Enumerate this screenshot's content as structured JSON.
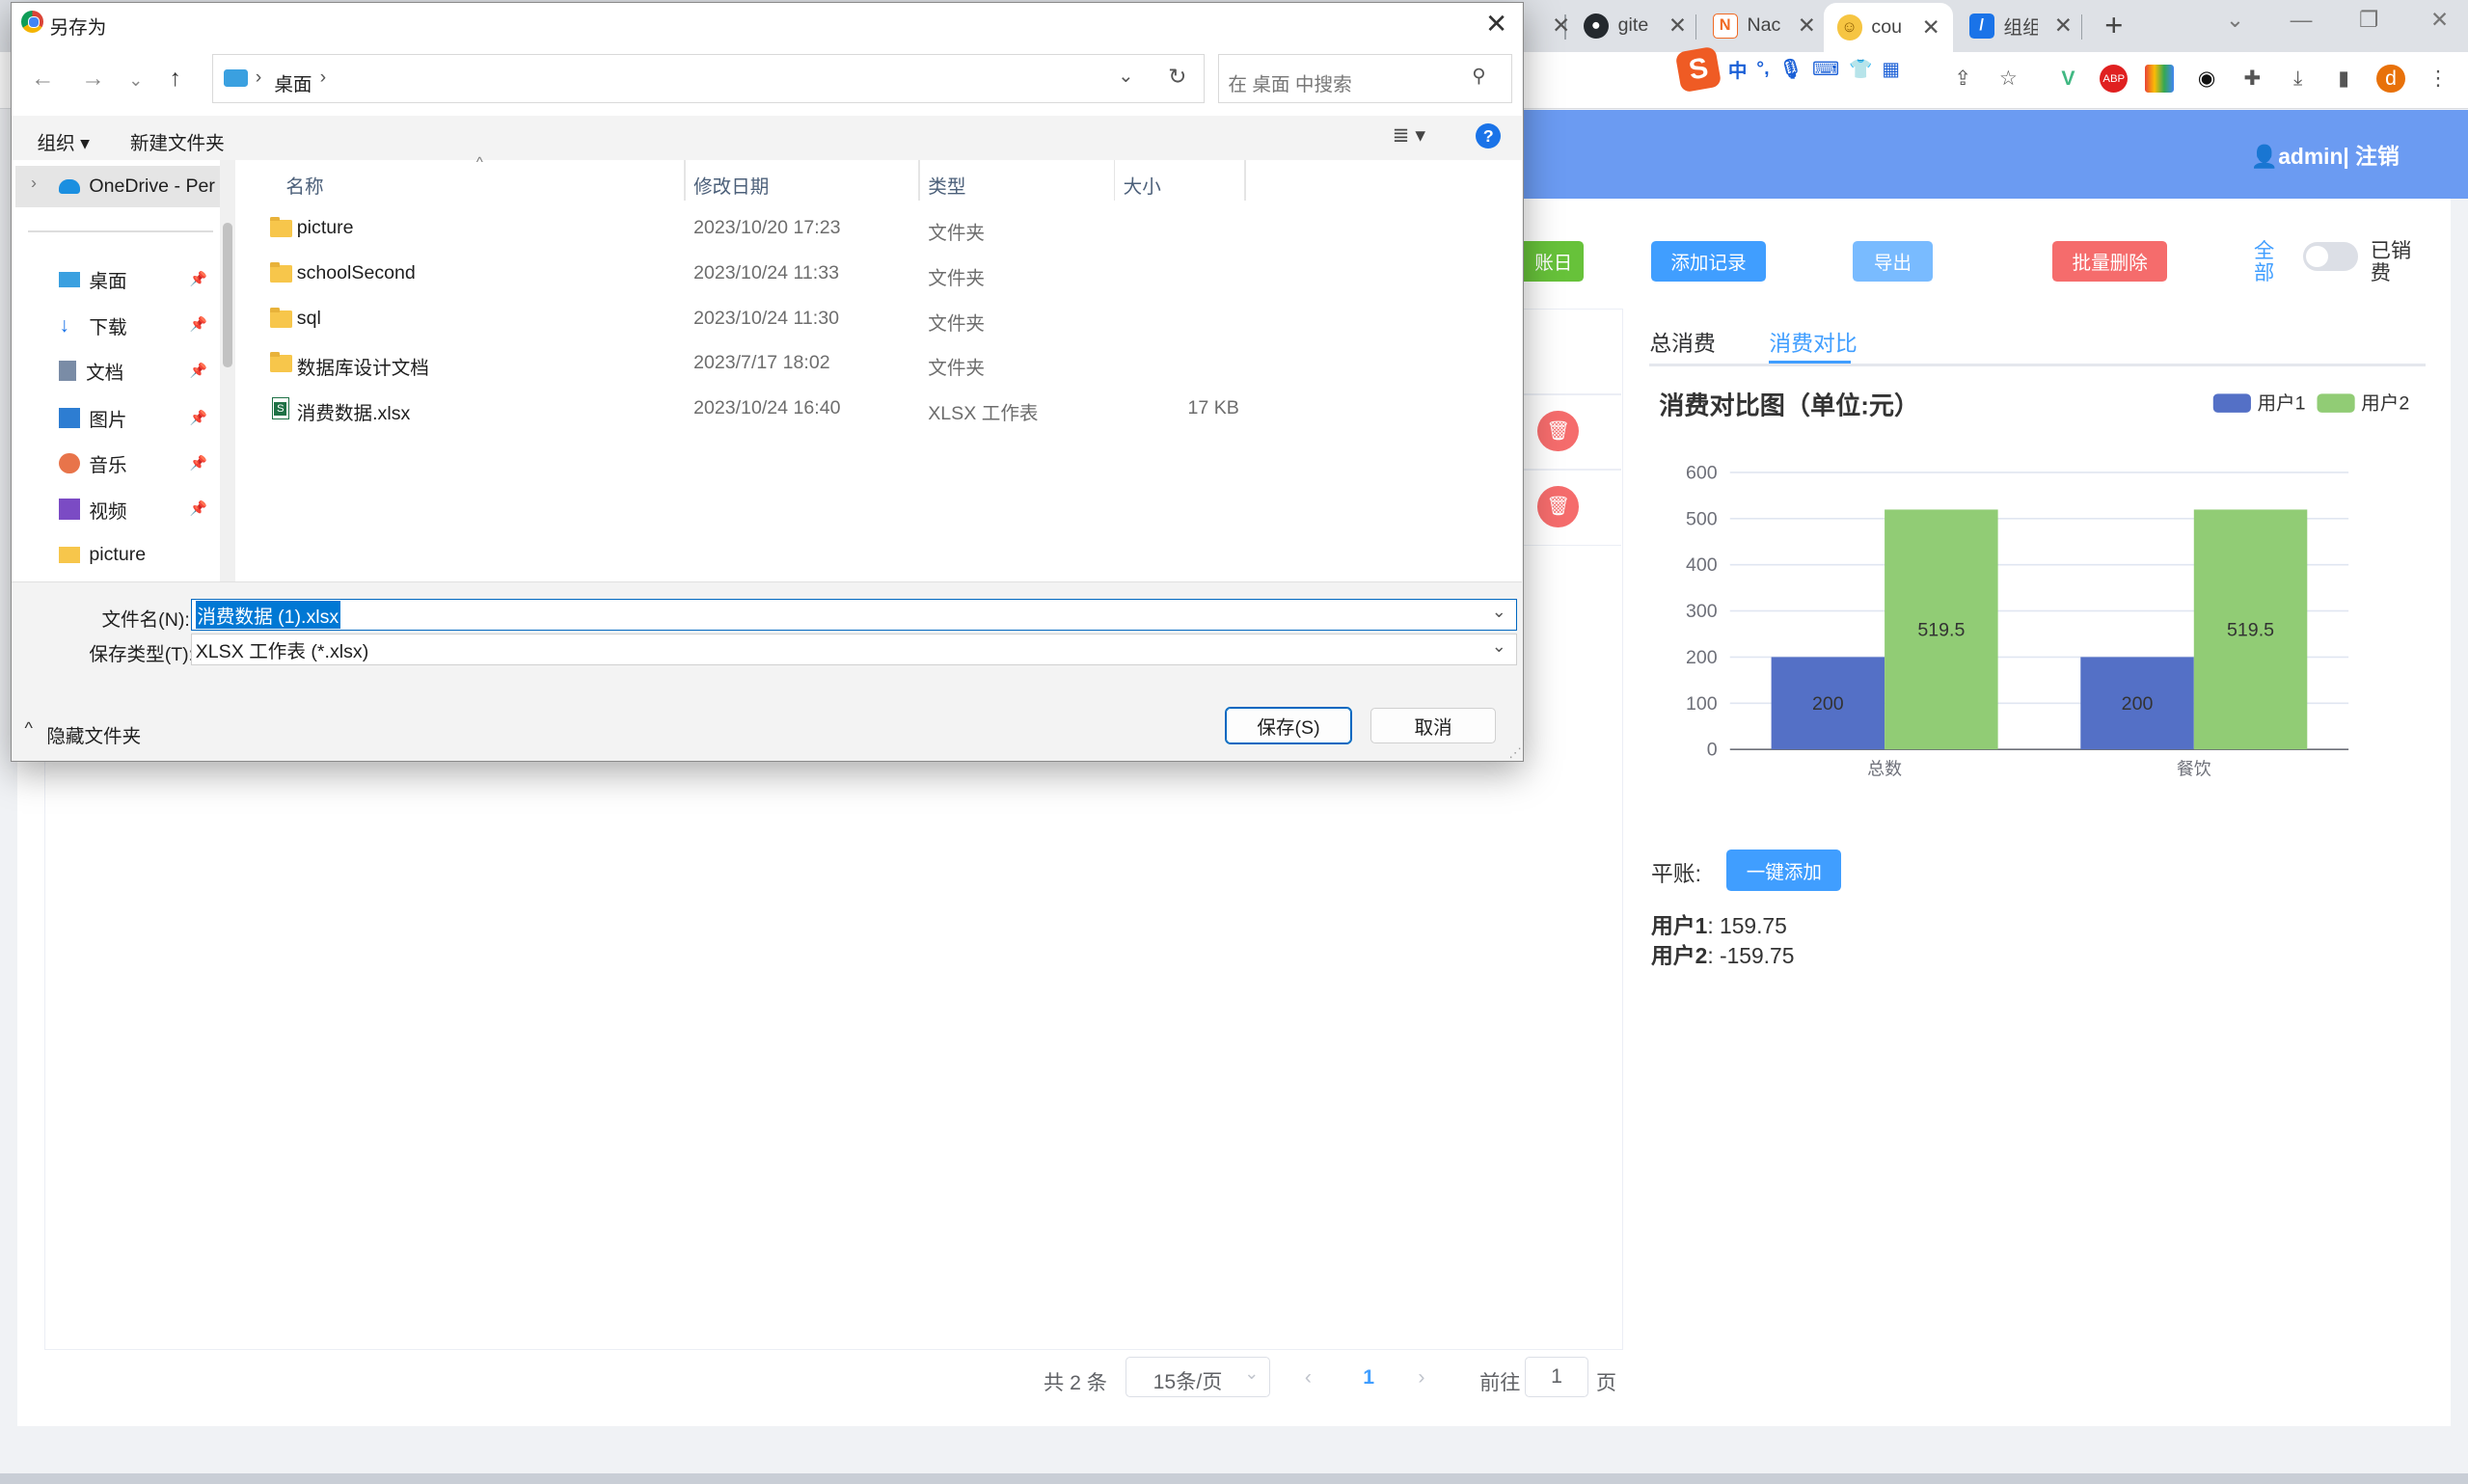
{
  "browser": {
    "tabs": [
      {
        "title": "gite",
        "favicon": "github-icon"
      },
      {
        "title": "Nac",
        "favicon": "nacos-icon"
      },
      {
        "title": "cou",
        "favicon": "smiley-icon"
      },
      {
        "title": "组组",
        "favicon": "app-icon"
      }
    ],
    "new_tab": "+",
    "ime": {
      "lang": "中",
      "punct": "°,"
    }
  },
  "app": {
    "header_user": "admin| 注销",
    "buttons": {
      "bill_day": "账日",
      "add_record": "添加记录",
      "export": "导出",
      "batch_delete": "批量删除"
    },
    "filter_all": "全部",
    "settled_label": "已销费",
    "tabs": [
      "总消费",
      "消费对比"
    ],
    "balance": {
      "label": "平账:",
      "button": "一键添加",
      "users": [
        {
          "name": "用户1",
          "value": ": 159.75"
        },
        {
          "name": "用户2",
          "value": ": -159.75"
        }
      ]
    },
    "pagination": {
      "total": "共 2 条",
      "page_size": "15条/页",
      "current": "1",
      "goto_prefix": "前往",
      "goto_value": "1",
      "goto_suffix": "页"
    },
    "colors": {
      "header": "#6b9bf2",
      "primary": "#409eff",
      "danger": "#f56c6c",
      "success": "#67c23a",
      "series1": "#5470c6",
      "series2": "#91cc75"
    }
  },
  "chart_data": {
    "type": "bar",
    "title": "消费对比图（单位:元）",
    "categories": [
      "总数",
      "餐饮"
    ],
    "series": [
      {
        "name": "用户1",
        "values": [
          200,
          200
        ]
      },
      {
        "name": "用户2",
        "values": [
          519.5,
          519.5
        ]
      }
    ],
    "ylim": [
      0,
      600
    ],
    "yticks": [
      0,
      100,
      200,
      300,
      400,
      500,
      600
    ],
    "legend": "top-right",
    "grid": true
  },
  "dialog": {
    "title": "另存为",
    "breadcrumb": "桌面",
    "search_placeholder": "在 桌面 中搜索",
    "organize": "组织 ▾",
    "new_folder": "新建文件夹",
    "nav_items": [
      {
        "label": "OneDrive - Per",
        "icon": "cloud-icon",
        "pinned": false
      },
      {
        "label": "桌面",
        "icon": "desktop-icon",
        "pinned": true
      },
      {
        "label": "下载",
        "icon": "download-icon",
        "pinned": true
      },
      {
        "label": "文档",
        "icon": "document-icon",
        "pinned": true
      },
      {
        "label": "图片",
        "icon": "picture-icon",
        "pinned": true
      },
      {
        "label": "音乐",
        "icon": "music-icon",
        "pinned": true
      },
      {
        "label": "视频",
        "icon": "video-icon",
        "pinned": true
      },
      {
        "label": "picture",
        "icon": "folder-icon",
        "pinned": false
      }
    ],
    "columns": [
      "名称",
      "修改日期",
      "类型",
      "大小"
    ],
    "files": [
      {
        "name": "picture",
        "date": "2023/10/20 17:23",
        "type": "文件夹",
        "size": ""
      },
      {
        "name": "schoolSecond",
        "date": "2023/10/24 11:33",
        "type": "文件夹",
        "size": ""
      },
      {
        "name": "sql",
        "date": "2023/10/24 11:30",
        "type": "文件夹",
        "size": ""
      },
      {
        "name": "数据库设计文档",
        "date": "2023/7/17 18:02",
        "type": "文件夹",
        "size": ""
      },
      {
        "name": "消费数据.xlsx",
        "date": "2023/10/24 16:40",
        "type": "XLSX 工作表",
        "size": "17 KB"
      }
    ],
    "filename_label": "文件名(N):",
    "filename_value": "消费数据 (1).xlsx",
    "filetype_label": "保存类型(T):",
    "filetype_value": "XLSX 工作表 (*.xlsx)",
    "hide_folders": "隐藏文件夹",
    "save": "保存(S)",
    "cancel": "取消"
  }
}
